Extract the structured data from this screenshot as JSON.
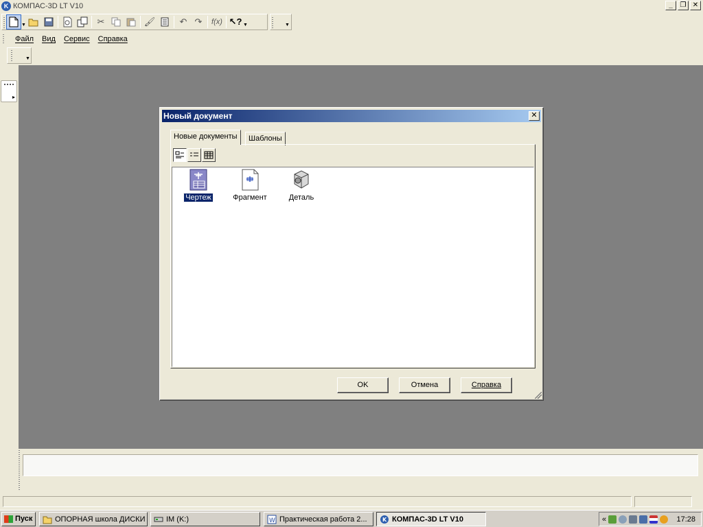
{
  "window": {
    "title": "КОМПАС-3D LT V10",
    "icon_letter": "K"
  },
  "menu": [
    "Файл",
    "Вид",
    "Сервис",
    "Справка"
  ],
  "dialog": {
    "title": "Новый документ",
    "tabs": [
      "Новые документы",
      "Шаблоны"
    ],
    "active_tab": "Новые документы",
    "documents": [
      {
        "label": "Чертеж",
        "icon": "drawing-icon",
        "selected": true
      },
      {
        "label": "Фрагмент",
        "icon": "fragment-icon",
        "selected": false
      },
      {
        "label": "Деталь",
        "icon": "part-icon",
        "selected": false
      }
    ],
    "buttons": {
      "ok": "OK",
      "cancel": "Отмена",
      "help": "Справка"
    }
  },
  "taskbar": {
    "start": "Пуск",
    "tasks": [
      {
        "label": "ОПОРНАЯ школа ДИСКИ",
        "icon": "folder-icon",
        "active": false
      },
      {
        "label": "IM (K:)",
        "icon": "drive-icon",
        "active": false
      },
      {
        "label": "Практическая работа 2...",
        "icon": "word-icon",
        "active": false
      },
      {
        "label": "КОМПАС-3D LT V10",
        "icon": "kompas-icon",
        "active": true
      }
    ],
    "tray_expand": "«",
    "clock": "17:28"
  },
  "colors": {
    "dialog_title_start": "#0a246a",
    "dialog_title_end": "#a6caf0",
    "workspace": "#808080",
    "selection": "#0a246a"
  }
}
